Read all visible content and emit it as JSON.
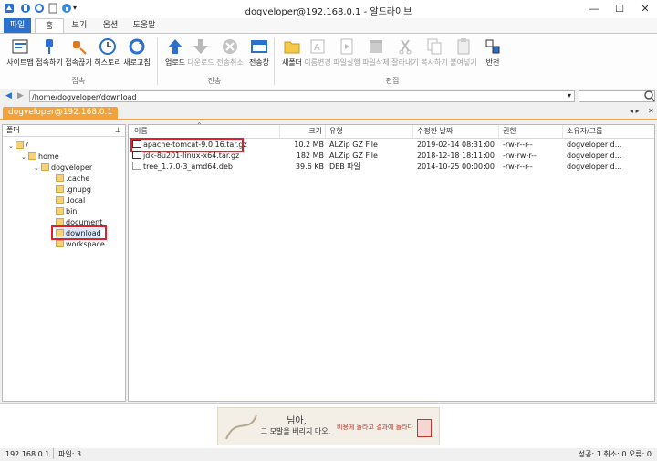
{
  "window": {
    "title": "dogveloper@192.168.0.1 - 알드라이브"
  },
  "ribbon_tabs": [
    "파일",
    "홈",
    "보기",
    "옵션",
    "도움말"
  ],
  "ribbon": {
    "connect": [
      {
        "label": "사이트맵",
        "icon": "sitemap-icon"
      },
      {
        "label": "접속하기",
        "icon": "plug-icon"
      },
      {
        "label": "접속끊기",
        "icon": "unplug-icon"
      },
      {
        "label": "히스토리",
        "icon": "clock-icon"
      },
      {
        "label": "새로고침",
        "icon": "refresh-icon"
      }
    ],
    "connect_group": "접속",
    "transfer": [
      {
        "label": "업로드",
        "icon": "upload-icon"
      },
      {
        "label": "다운로드",
        "icon": "download-icon"
      },
      {
        "label": "전송취소",
        "icon": "cancel-icon"
      },
      {
        "label": "전송창",
        "icon": "transfer-window-icon"
      }
    ],
    "transfer_group": "전송",
    "edit": [
      {
        "label": "새폴더",
        "icon": "new-folder-icon"
      },
      {
        "label": "이름변경",
        "icon": "rename-icon"
      },
      {
        "label": "파일실행",
        "icon": "run-file-icon"
      },
      {
        "label": "파일삭제",
        "icon": "delete-icon"
      },
      {
        "label": "잘라내기",
        "icon": "cut-icon"
      },
      {
        "label": "복사하기",
        "icon": "copy-icon"
      },
      {
        "label": "붙여넣기",
        "icon": "paste-icon"
      },
      {
        "label": "반전",
        "icon": "invert-icon"
      }
    ],
    "edit_group": "편집"
  },
  "address": {
    "path": "/home/dogveloper/download"
  },
  "connection_tab": "dogveloper@192.168.0.1",
  "folder_pane": {
    "header": "폴더",
    "tree": [
      {
        "label": "/",
        "level": 0
      },
      {
        "label": "home",
        "level": 1
      },
      {
        "label": "dogveloper",
        "level": 2
      },
      {
        "label": ".cache",
        "level": 3
      },
      {
        "label": ".gnupg",
        "level": 3
      },
      {
        "label": ".local",
        "level": 3
      },
      {
        "label": "bin",
        "level": 3
      },
      {
        "label": "document",
        "level": 3
      },
      {
        "label": "download",
        "level": 3
      },
      {
        "label": "workspace",
        "level": 3
      }
    ]
  },
  "file_list": {
    "columns": [
      "이름",
      "크기",
      "유형",
      "수정한 날짜",
      "권한",
      "소유자/그룹"
    ],
    "rows": [
      {
        "name": "apache-tomcat-9.0.16.tar.gz",
        "size": "10.2 MB",
        "type": "ALZip GZ File",
        "date": "2019-02-14 08:31:00",
        "perm": "-rw-r--r--",
        "owner": "dogveloper d..."
      },
      {
        "name": "jdk-8u201-linux-x64.tar.gz",
        "size": "182 MB",
        "type": "ALZip GZ File",
        "date": "2018-12-18 18:11:00",
        "perm": "-rw-rw-r--",
        "owner": "dogveloper d..."
      },
      {
        "name": "tree_1.7.0-3_amd64.deb",
        "size": "39.6 KB",
        "type": "DEB 파일",
        "date": "2014-10-25 00:00:00",
        "perm": "-rw-r--r--",
        "owner": "dogveloper d..."
      }
    ]
  },
  "banner": {
    "line1": "님아,",
    "line2": "그 모발을 버리지 마오.",
    "line3": "비용에 놀라고 결과에 놀라다"
  },
  "status": {
    "host": "192.168.0.1",
    "files": "파일: 3",
    "summary": "성공: 1 취소: 0 오류: 0"
  },
  "colors": {
    "accent": "#2b6fcf",
    "tab_orange": "#f2a23c",
    "highlight": "#e0202a"
  }
}
